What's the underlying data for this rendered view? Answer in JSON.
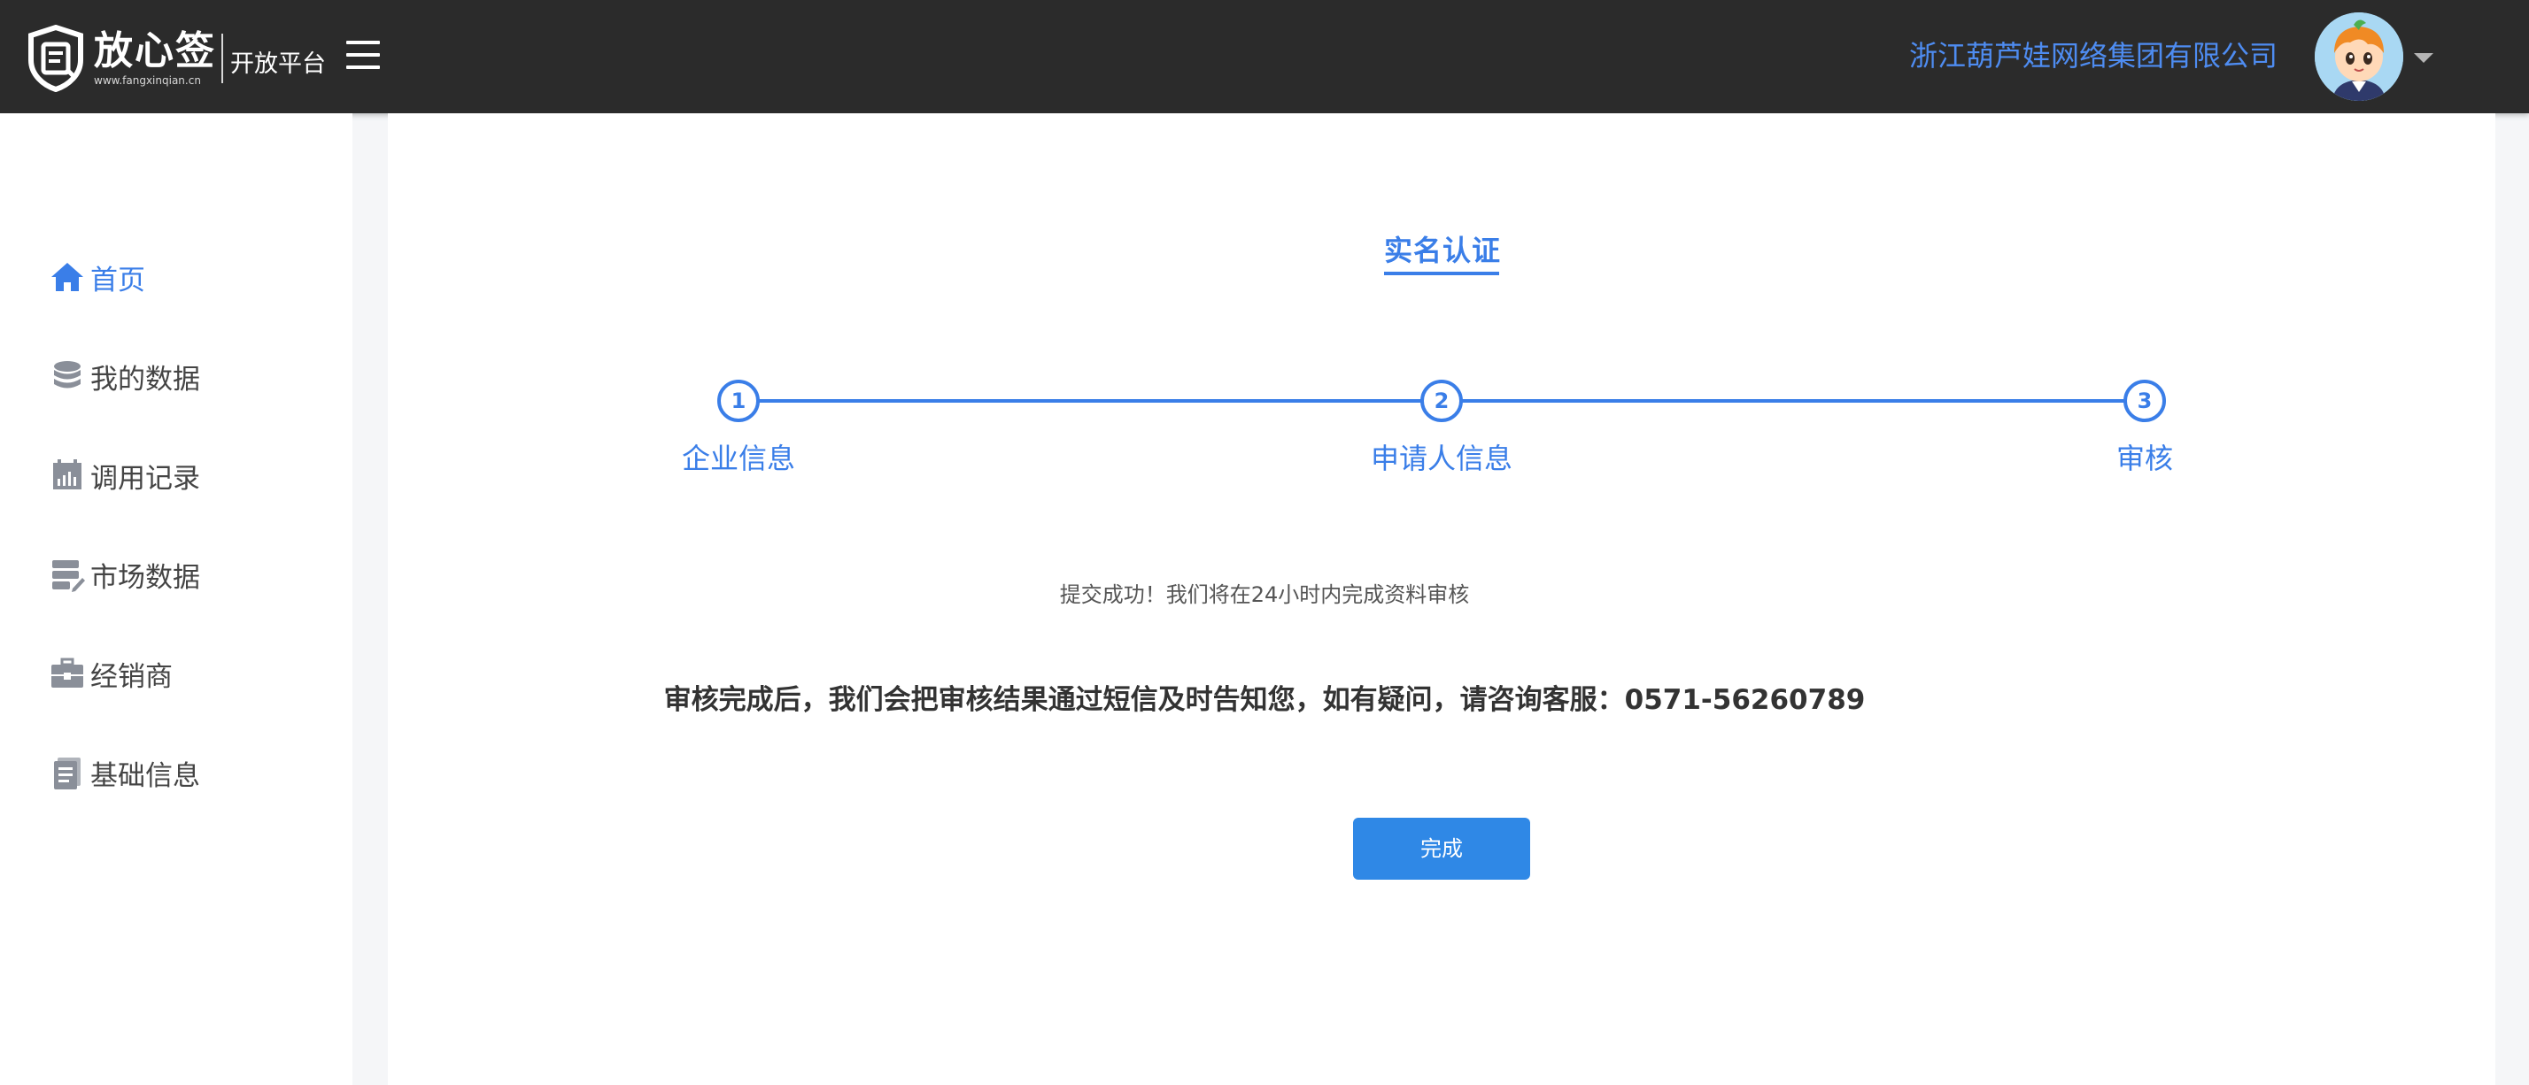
{
  "header": {
    "logo_title": "放心签",
    "logo_domain": "www.fangxinqian.cn",
    "logo_subtitle": "开放平台",
    "company_name": "浙江葫芦娃网络集团有限公司"
  },
  "sidebar": {
    "items": [
      {
        "label": "首页",
        "icon": "home-icon",
        "active": true
      },
      {
        "label": "我的数据",
        "icon": "database-icon",
        "active": false
      },
      {
        "label": "调用记录",
        "icon": "calendar-chart-icon",
        "active": false
      },
      {
        "label": "市场数据",
        "icon": "server-edit-icon",
        "active": false
      },
      {
        "label": "经销商",
        "icon": "briefcase-icon",
        "active": false
      },
      {
        "label": "基础信息",
        "icon": "document-icon",
        "active": false
      }
    ]
  },
  "main": {
    "tab_title": "实名认证",
    "steps": [
      {
        "number": "1",
        "label": "企业信息"
      },
      {
        "number": "2",
        "label": "申请人信息"
      },
      {
        "number": "3",
        "label": "审核"
      }
    ],
    "success_message": "提交成功！我们将在24小时内完成资料审核",
    "notice_message": "审核完成后，我们会把审核结果通过短信及时告知您，如有疑问，请咨询客服：0571-56260789",
    "done_button": "完成"
  },
  "colors": {
    "accent": "#3a7ee8",
    "topbar": "#2b2b2b",
    "button": "#2f88e6"
  }
}
